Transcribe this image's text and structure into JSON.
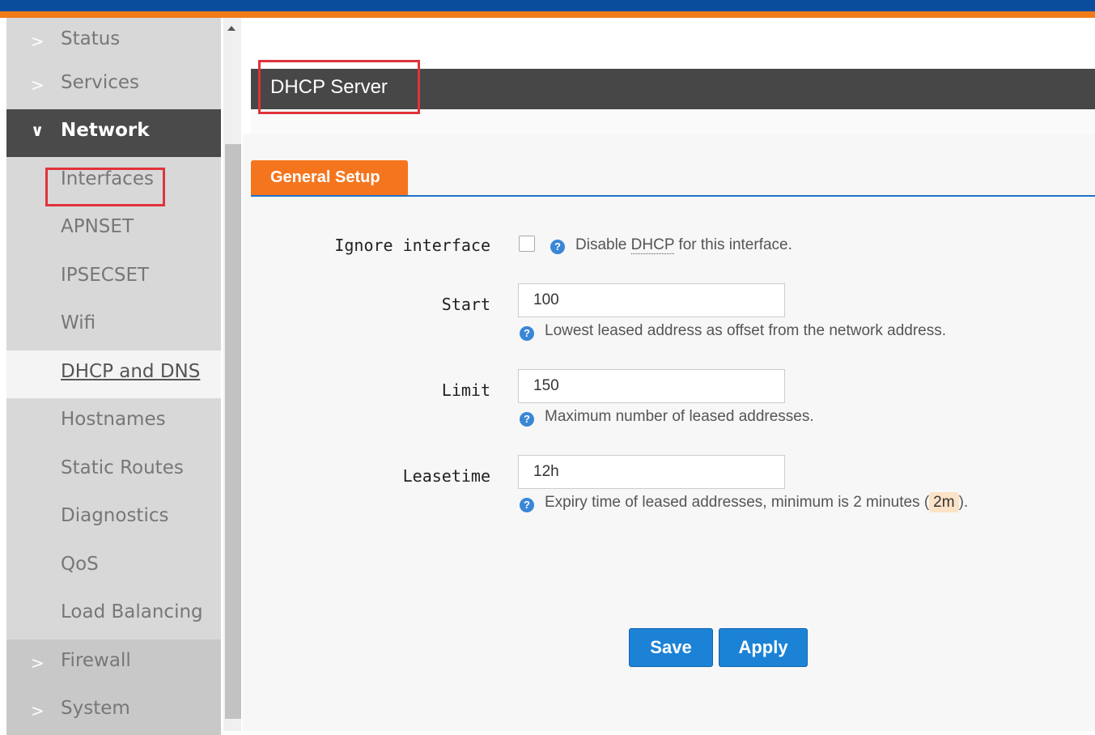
{
  "sidebar": {
    "items": [
      {
        "label": "Status",
        "chevron": ">"
      },
      {
        "label": "Services",
        "chevron": ">"
      },
      {
        "label": "Network",
        "chevron": "∨"
      },
      {
        "label": "Interfaces"
      },
      {
        "label": "APNSET"
      },
      {
        "label": "IPSECSET"
      },
      {
        "label": "Wifi"
      },
      {
        "label": "DHCP and DNS"
      },
      {
        "label": "Hostnames"
      },
      {
        "label": "Static Routes"
      },
      {
        "label": "Diagnostics"
      },
      {
        "label": "QoS"
      },
      {
        "label": "Load Balancing"
      },
      {
        "label": "Firewall",
        "chevron": ">"
      },
      {
        "label": "System",
        "chevron": ">"
      }
    ]
  },
  "page": {
    "title": "DHCP Server",
    "tab_label": "General Setup"
  },
  "form": {
    "ignore_interface": {
      "label": "Ignore interface",
      "checked": false,
      "help_prefix": "Disable ",
      "help_abbr": "DHCP",
      "help_suffix": " for this interface."
    },
    "start": {
      "label": "Start",
      "value": "100",
      "help": "Lowest leased address as offset from the network address."
    },
    "limit": {
      "label": "Limit",
      "value": "150",
      "help": "Maximum number of leased addresses."
    },
    "leasetime": {
      "label": "Leasetime",
      "value": "12h",
      "help_prefix": "Expiry time of leased addresses, minimum is 2 minutes (",
      "help_code": "2m",
      "help_suffix": ")."
    }
  },
  "buttons": {
    "save": "Save",
    "apply": "Apply"
  },
  "icons": {
    "help": "?"
  },
  "colors": {
    "accent_orange": "#f5751e",
    "header_blue": "#0a4d9c",
    "button_blue": "#1c82d6",
    "title_bar": "#474747"
  }
}
